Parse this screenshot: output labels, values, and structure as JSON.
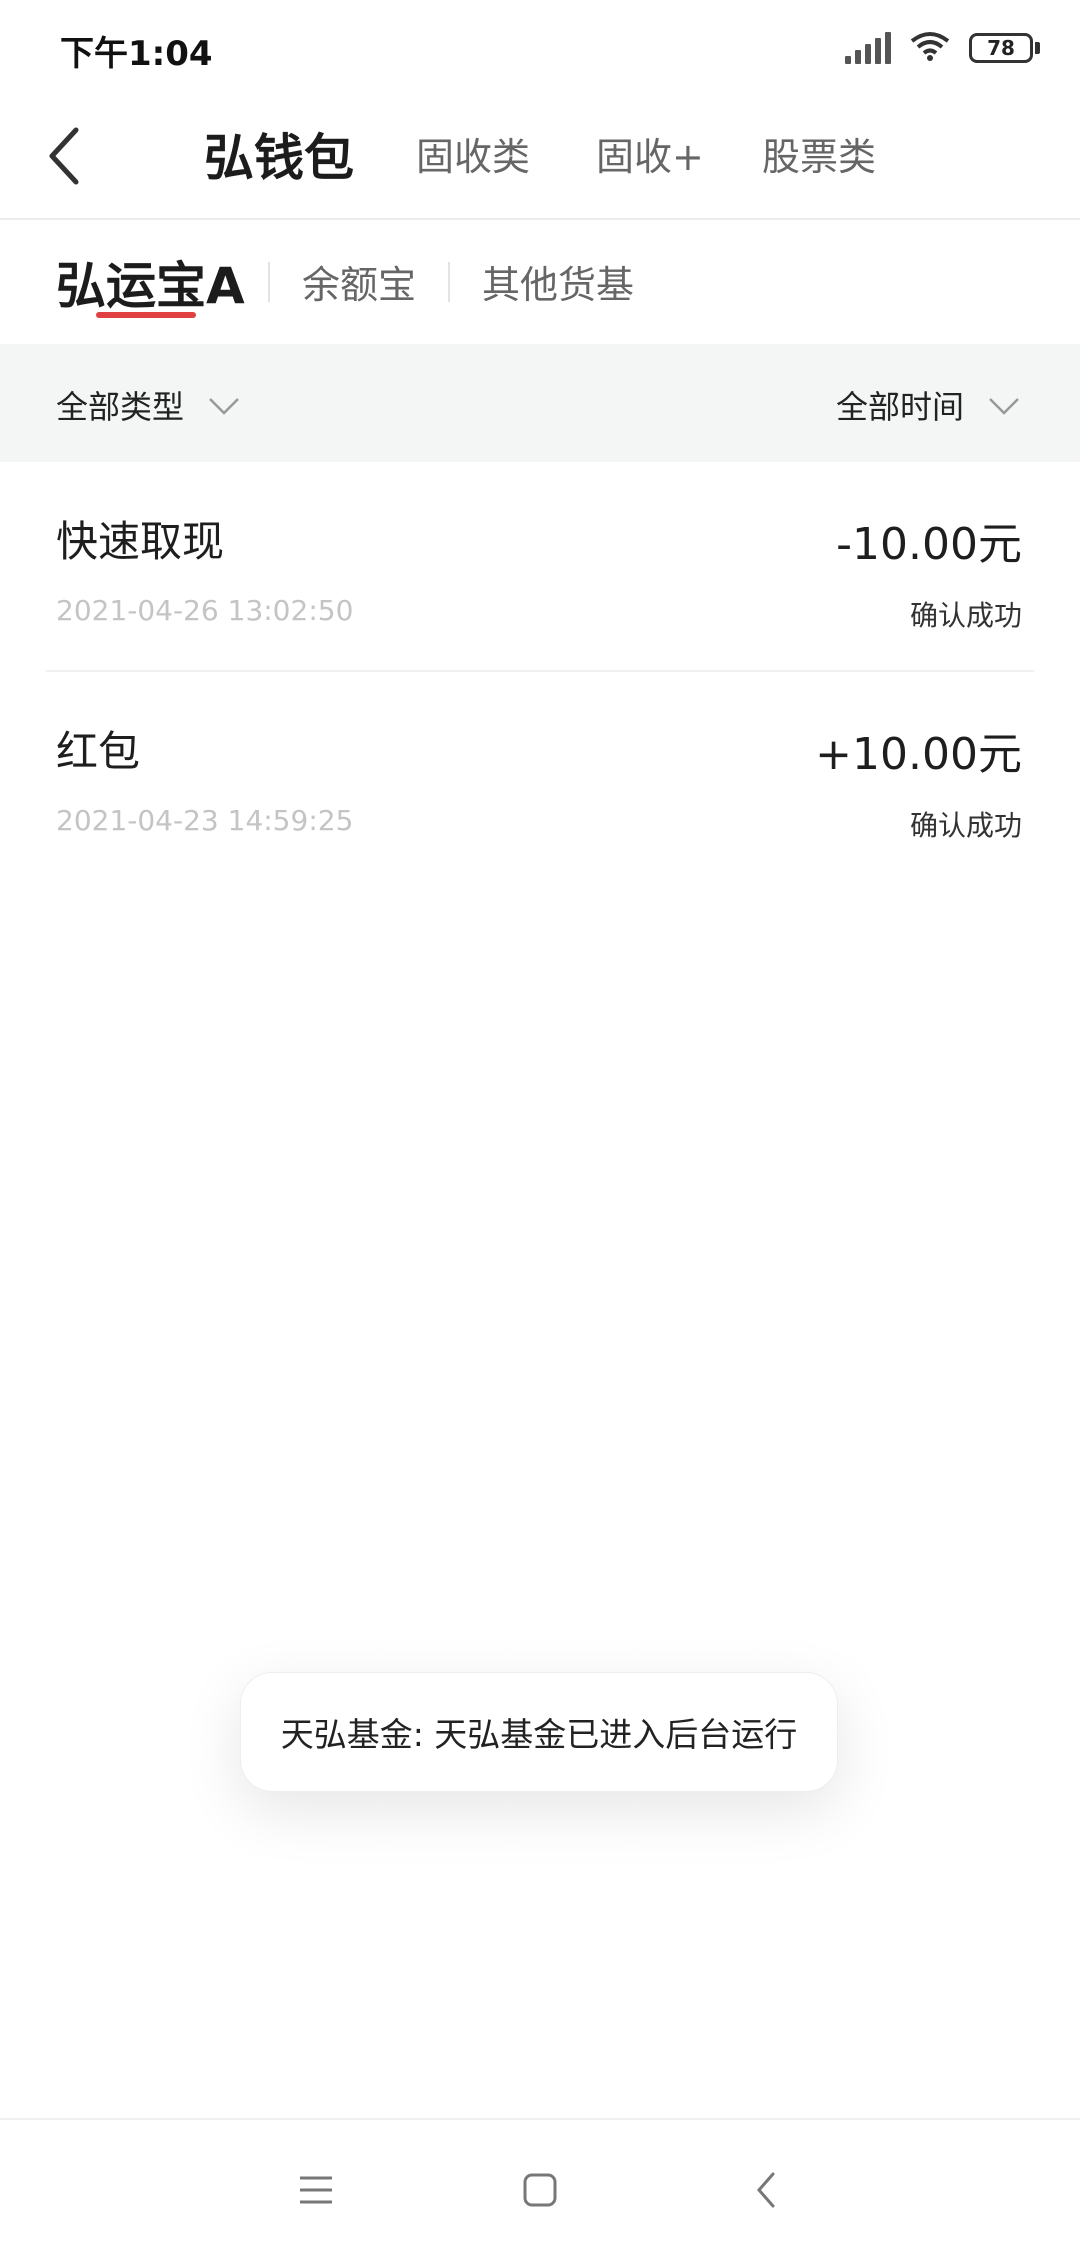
{
  "status_bar": {
    "time": "下午1:04",
    "battery": "78"
  },
  "top_nav": {
    "tabs": [
      "弘钱包",
      "固收类",
      "固收+",
      "股票类"
    ],
    "active_index": 0
  },
  "sub_tabs": {
    "tabs": [
      "弘运宝A",
      "余额宝",
      "其他货基"
    ],
    "active_index": 0
  },
  "filters": {
    "type_label": "全部类型",
    "time_label": "全部时间"
  },
  "transactions": [
    {
      "title": "快速取现",
      "date": "2021-04-26 13:02:50",
      "amount": "-10.00元",
      "status": "确认成功"
    },
    {
      "title": "红包",
      "date": "2021-04-23 14:59:25",
      "amount": "+10.00元",
      "status": "确认成功"
    }
  ],
  "toast": {
    "message": "天弘基金: 天弘基金已进入后台运行"
  },
  "icons": {
    "back": "chevron-left-icon",
    "dropdown": "chevron-down-icon",
    "menu": "menu-icon",
    "home": "square-icon",
    "nav_back": "chevron-left-icon"
  },
  "colors": {
    "accent": "#e0403f",
    "filter_bg": "#f4f5f5"
  }
}
